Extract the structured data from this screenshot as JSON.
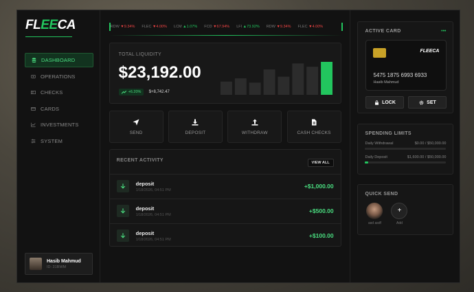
{
  "brand": {
    "pre": "FL",
    "accent": "EE",
    "post": "CA"
  },
  "nav": [
    {
      "label": "DASHBOARD",
      "icon": "database-icon",
      "active": true
    },
    {
      "label": "OPERATIONS",
      "icon": "exchange-icon",
      "active": false
    },
    {
      "label": "CHECKS",
      "icon": "check-icon",
      "active": false
    },
    {
      "label": "CARDS",
      "icon": "card-icon",
      "active": false
    },
    {
      "label": "INVESTMENTS",
      "icon": "chart-line-icon",
      "active": false
    },
    {
      "label": "SYSTEM",
      "icon": "sliders-icon",
      "active": false
    }
  ],
  "user": {
    "name": "Hasib Mahmud",
    "id": "ID: 31BWM"
  },
  "ticker": [
    {
      "sym": "RDW",
      "dir": "dn",
      "val": "9.34%"
    },
    {
      "sym": "FLEC",
      "dir": "dn",
      "val": "4.00%"
    },
    {
      "sym": "LCM",
      "dir": "up",
      "val": "1.07%"
    },
    {
      "sym": "FCD",
      "dir": "dn",
      "val": "67.94%"
    },
    {
      "sym": "LFI",
      "dir": "up",
      "val": "73.92%"
    },
    {
      "sym": "RDW",
      "dir": "dn",
      "val": "9.34%"
    },
    {
      "sym": "FLEC",
      "dir": "dn",
      "val": "4.00%"
    }
  ],
  "liquidity": {
    "label": "TOTAL LIQUIDITY",
    "amount": "$23,192.00",
    "badge": "+6.20%",
    "delta": "$+8,742.47",
    "bars": [
      0.4,
      0.5,
      0.37,
      0.77,
      0.55,
      0.95,
      0.85,
      1.0
    ]
  },
  "actions": [
    {
      "label": "SEND",
      "icon": "send-icon"
    },
    {
      "label": "DEPOSIT",
      "icon": "download-icon"
    },
    {
      "label": "WITHDRAW",
      "icon": "upload-icon"
    },
    {
      "label": "CASH CHECKS",
      "icon": "document-icon"
    }
  ],
  "activity": {
    "title": "RECENT ACTIVITY",
    "view_all": "VIEW ALL",
    "rows": [
      {
        "type": "deposit",
        "date": "1/18/2026, 04:51 PM",
        "amount": "+$1,000.00"
      },
      {
        "type": "deposit",
        "date": "1/18/2026, 04:51 PM",
        "amount": "+$500.00"
      },
      {
        "type": "deposit",
        "date": "1/18/2026, 04:51 PM",
        "amount": "+$100.00"
      }
    ]
  },
  "active_card": {
    "title": "ACTIVE CARD",
    "dots": "•••",
    "brand": "FLEECA",
    "number": "5475 1875 6993 6933",
    "holder": "Hasib Mahmud",
    "lock": "LOCK",
    "set": "SET"
  },
  "limits": {
    "title": "SPENDING LIMITS",
    "items": [
      {
        "label": "Daily Withdrawal",
        "value": "$0.00 / $50,000.00",
        "fraction": 0
      },
      {
        "label": "Daily Deposit",
        "value": "$1,600.00 / $50,000.00",
        "fraction": 0.032
      }
    ]
  },
  "quick_send": {
    "title": "QUICK SEND",
    "people": [
      {
        "name": "asd asdf"
      }
    ],
    "add_label": "Add",
    "add_symbol": "+"
  },
  "colors": {
    "accent": "#22c55e",
    "negative": "#ef4444",
    "chip": "#c9a227"
  }
}
